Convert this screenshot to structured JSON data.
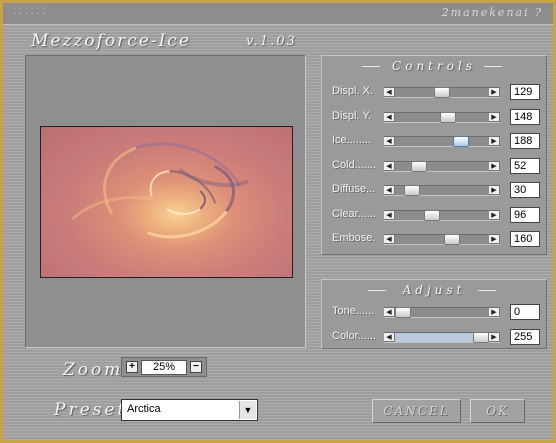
{
  "window": {
    "title_dots": "⁚⁚⁚⁚⁚⁚",
    "author": "2manekenai ?",
    "app_title": "Mezzoforce-Ice",
    "version": "v.1.03"
  },
  "controls": {
    "title": "Controls",
    "sliders": [
      {
        "label": "Displ. X.",
        "value": "129",
        "max": 255,
        "active": false
      },
      {
        "label": "Displ. Y.",
        "value": "148",
        "max": 255,
        "active": false
      },
      {
        "label": "Ice........",
        "value": "188",
        "max": 255,
        "active": true
      },
      {
        "label": "Cold.......",
        "value": "52",
        "max": 255,
        "active": false
      },
      {
        "label": "Diffuse...",
        "value": "30",
        "max": 255,
        "active": false
      },
      {
        "label": "Clear......",
        "value": "96",
        "max": 255,
        "active": false
      },
      {
        "label": "Embose.",
        "value": "160",
        "max": 255,
        "active": false
      }
    ]
  },
  "adjust": {
    "title": "Adjust",
    "sliders": [
      {
        "label": "Tone......",
        "value": "0",
        "max": 255,
        "active": false,
        "fill": false
      },
      {
        "label": "Color......",
        "value": "255",
        "max": 255,
        "active": false,
        "fill": true
      }
    ]
  },
  "zoom": {
    "label": "Zoom",
    "plus": "+",
    "value": "25%",
    "minus": "−"
  },
  "preset": {
    "label": "Preset",
    "value": "Arctica",
    "arrow": "▼"
  },
  "buttons": {
    "cancel": "CANCEL",
    "ok": "OK"
  },
  "icons": {
    "left_arrow": "◀",
    "right_arrow": "▶"
  },
  "colors": {
    "frame": "#c9a149",
    "slider_fill": "#b8c9dd"
  }
}
